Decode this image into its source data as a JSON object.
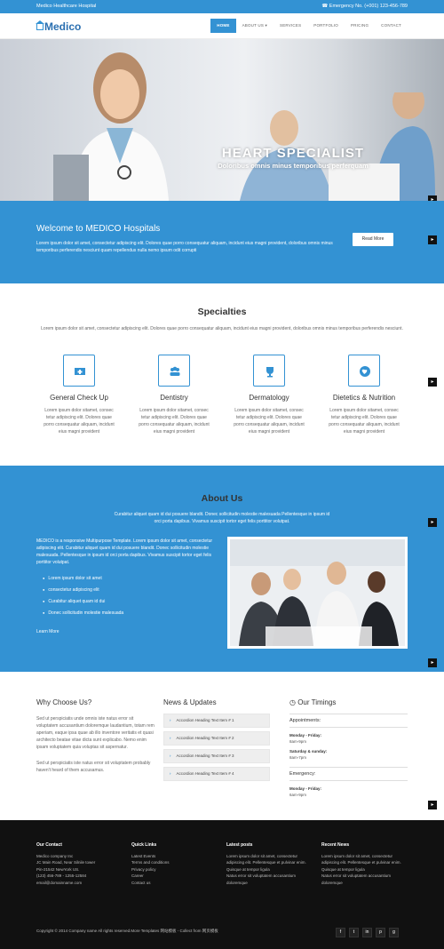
{
  "topbar": {
    "hospital_name": "Medico Healthcare Hospital",
    "emergency": "☎ Emergency No. (+001) 123-456-789"
  },
  "logo": {
    "text": "Medico"
  },
  "nav": [
    {
      "label": "HOME"
    },
    {
      "label": "ABOUT US ▾"
    },
    {
      "label": "SERVICES"
    },
    {
      "label": "PORTFOLIO"
    },
    {
      "label": "PRICING"
    },
    {
      "label": "CONTACT"
    }
  ],
  "hero": {
    "title": "HEART SPECIALIST",
    "subtitle": "Doloribus omnis minus temporibus perferquam"
  },
  "welcome": {
    "title": "Welcome to MEDICO Hospitals",
    "text": "Lorem ipsum dolor sit amet, consectetur adipiscing elit. Dolores quae porro consequatur aliquam, incidunt eius magni provident, doloribus omnis minus temporibus perferendis nesciunt quam repellendus nulla nemo ipsum odit corrupti",
    "button": "Read More"
  },
  "specialties": {
    "title": "Specialties",
    "text": "Lorem ipsum dolor sit amet, consectetur adipiscing elit. Dolores quae porro consequatur aliquam, incidunt eius magni provident, doloribus omnis minus temporibus perferendis nesciunt.",
    "cards": [
      {
        "icon": "ambulance-icon",
        "title": "General Check Up",
        "text": "Lorem ipsum dolor sitamet, consec tetur adipiscing elit. Dolores quae porro consequatur aliquam, incidunt eius magni provident"
      },
      {
        "icon": "users-icon",
        "title": "Dentistry",
        "text": "Lorem ipsum dolor sitamet, consec tetur adipiscing elit. Dolores quae porro consequatur aliquam, incidunt eius magni provident"
      },
      {
        "icon": "trophy-icon",
        "title": "Dermatology",
        "text": "Lorem ipsum dolor sitamet, consec tetur adipiscing elit. Dolores quae porro consequatur aliquam, incidunt eius magni provident"
      },
      {
        "icon": "globe-icon",
        "title": "Dietetics & Nutrition",
        "text": "Lorem ipsum dolor sitamet, consec tetur adipiscing elit. Dolores quae porro consequatur aliquam, incidunt eius magni provident"
      }
    ]
  },
  "about": {
    "title": "About Us",
    "intro": "Curabitur aliquet quam id dui posuere blandit. Donec sollicitudin molestie malesuada Pellentesque in ipsum id orci porta dapibus. Vivamus suscipit tortor eget felis porttitor volutpat.",
    "text": "MEDICO is a responsive Multipurpose Template. Lorem ipsum dolor sit amet, consectetur adipiscing elit. Curabitur aliquet quam id dui posuere blandit. Donec sollicitudin molestie malesuada. Pellentesque in ipsum id orci porta dapibus. Vivamus suscipit tortor eget felis porttitor volutpat.",
    "list": [
      "Lorem ipsum dolor sit amet",
      "consectetur adipiscing elit",
      "Curabitur aliquet quam id dui",
      "Donec sollicitudin molestie malesuada"
    ],
    "more": "Learn More"
  },
  "why": {
    "title": "Why Choose Us?",
    "p1": "Sed ut perspiciatis unde omnis iste natus error sit voluptatem accusantium doloremque laudantium, totam rem aperiam, eaque ipsa quae ab illo inventore veritatis et quasi architecto beatae vitae dicta sunt explicabo. Nemo enim ipsam voluptatem quia voluptas sit aspernatur.",
    "p2": "Sed ut perspiciatis iste natus error sit voluptatem probably haven't heard of them accusamus."
  },
  "news": {
    "title": "News & Updates",
    "items": [
      "Accordion Heading Text Item # 1",
      "Accordion Heading Text Item # 2",
      "Accordion Heading Text Item # 3",
      "Accordion Heading Text Item # 4"
    ]
  },
  "timings": {
    "title": "Our Timings",
    "appointments": "Appointments:",
    "slots": [
      {
        "day": "Monday - Friday:",
        "hours": "8am-9pm"
      },
      {
        "day": "Saturday & sunday:",
        "hours": "8am-7pm"
      }
    ],
    "emergency": "Emergency:",
    "emergency_slots": [
      {
        "day": "Monday - Friday:",
        "hours": "6am-9pm"
      }
    ]
  },
  "footer": {
    "contact": {
      "title": "Our Contact",
      "lines": [
        "Medico company Inc",
        "JC Main Road, Near Silnile tower",
        "Pin-21542 NewYork US.",
        "(123) 456-789 - 1255-12584",
        "email@domainname.com"
      ]
    },
    "links": {
      "title": "Quick Links",
      "lines": [
        "Latest Events",
        "Terms and conditions",
        "Privacy policy",
        "Career",
        "Contact us"
      ]
    },
    "latest": {
      "title": "Latest posts",
      "lines": [
        "Lorem ipsum dolor sit amet, consectetur adipiscing elit. Pellentesque et pulvinar enim. Quisque at tempor ligula",
        "Natus error sit voluptatem accusantium doloremque"
      ]
    },
    "recent": {
      "title": "Recent News",
      "lines": [
        "Lorem ipsum dolor sit amet, consectetur adipiscing elit. Pellentesque et pulvinar enim. Quisque at tempor ligula",
        "Natus error sit voluptatem accusantium doloremque"
      ]
    },
    "copyright": "Copyright © 2014 Company name All rights reserved.More Templates 网站模板 - Collect from 网页模板",
    "social": [
      "f",
      "t",
      "in",
      "p",
      "g"
    ]
  },
  "colors": {
    "accent": "#3392d3",
    "footer": "#111111"
  }
}
